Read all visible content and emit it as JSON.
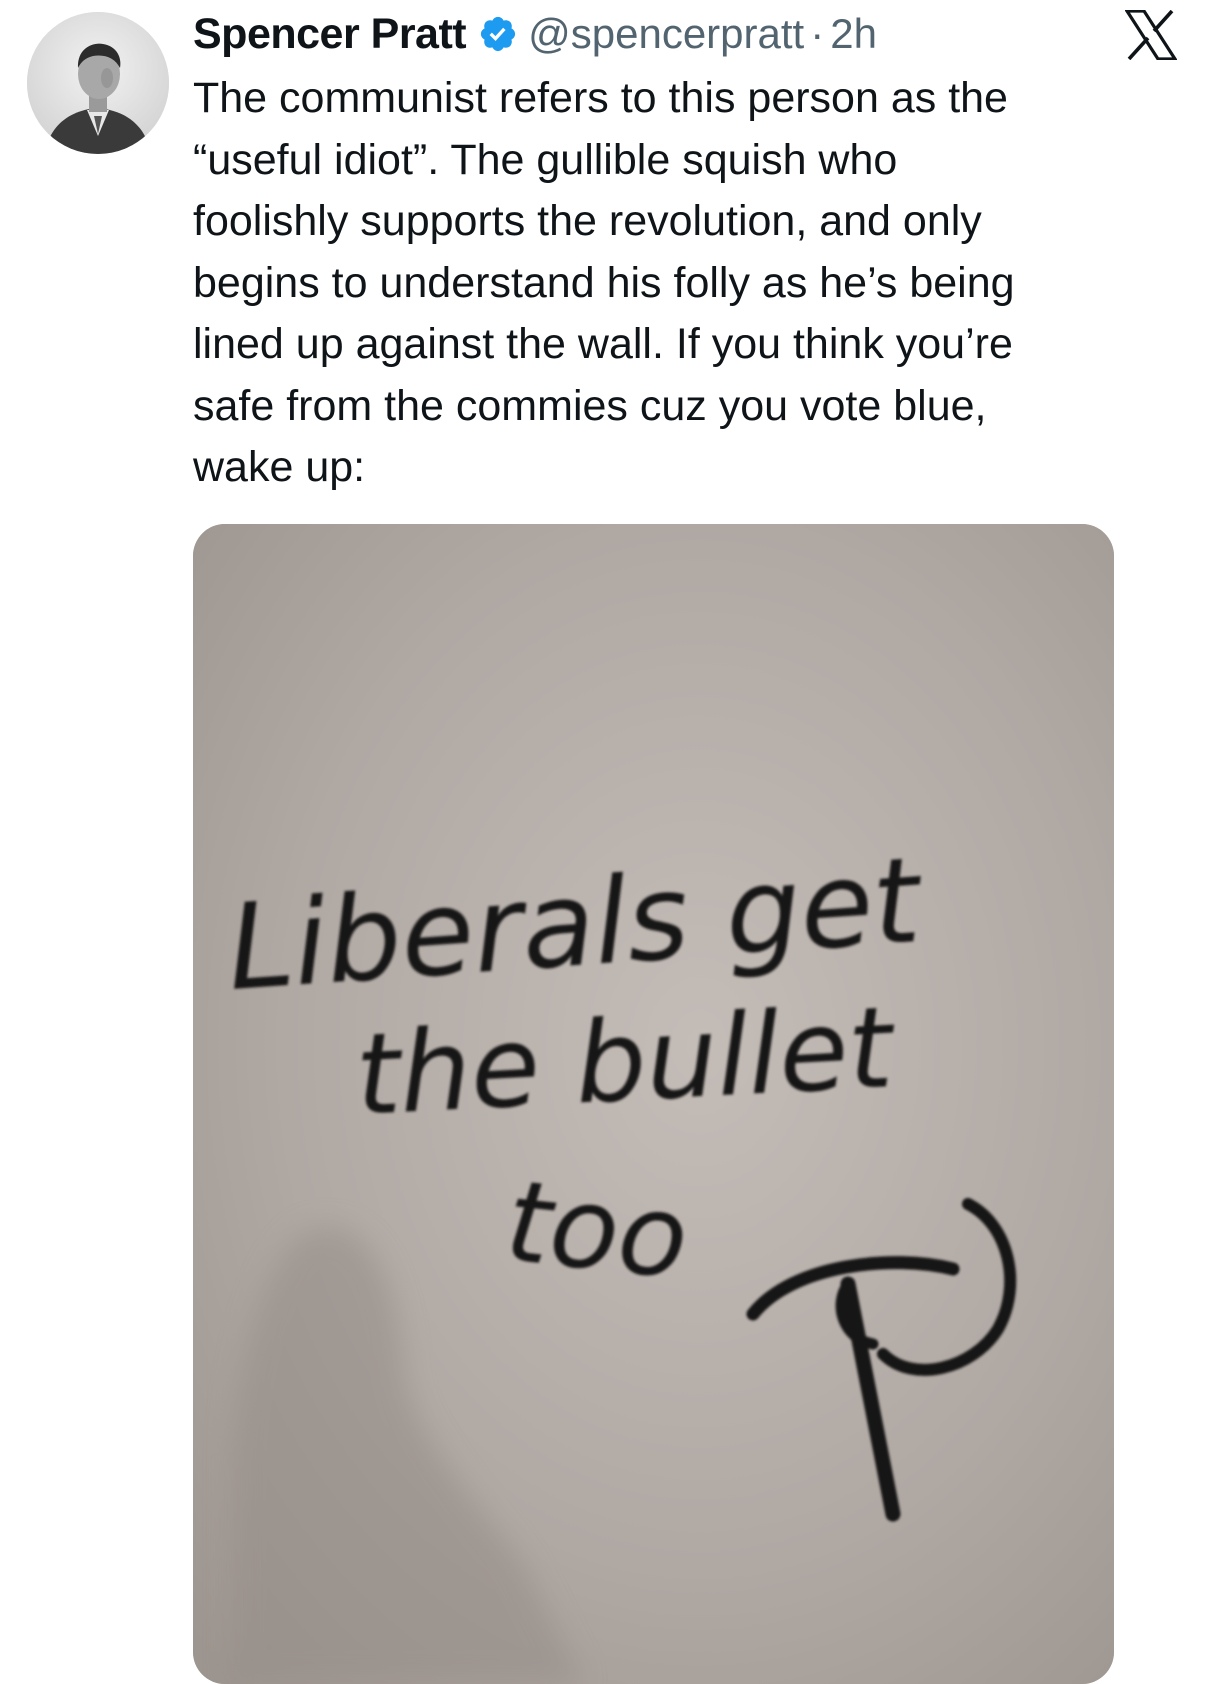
{
  "author": {
    "display_name": "Spencer Pratt",
    "handle": "@spencerpratt",
    "separator": "·",
    "timestamp": "2h",
    "verified": true,
    "verified_color": "#1d9bf0"
  },
  "tweet": {
    "text": "The communist refers to this person as the\n“useful idiot”. The gullible squish who\nfoolishly supports the revolution, and only\nbegins to understand his folly as he’s being\nlined up against the wall. If you think you’re\nsafe from the commies cuz you vote blue,\nwake up:"
  },
  "media": {
    "graffiti_line_1": "Liberals get",
    "graffiti_line_2": "the bullet",
    "graffiti_line_3": "too",
    "wall_color": "#b3aba6"
  },
  "icons": {
    "platform_logo": "x-logo-icon",
    "verified_badge": "verified-badge-icon"
  }
}
